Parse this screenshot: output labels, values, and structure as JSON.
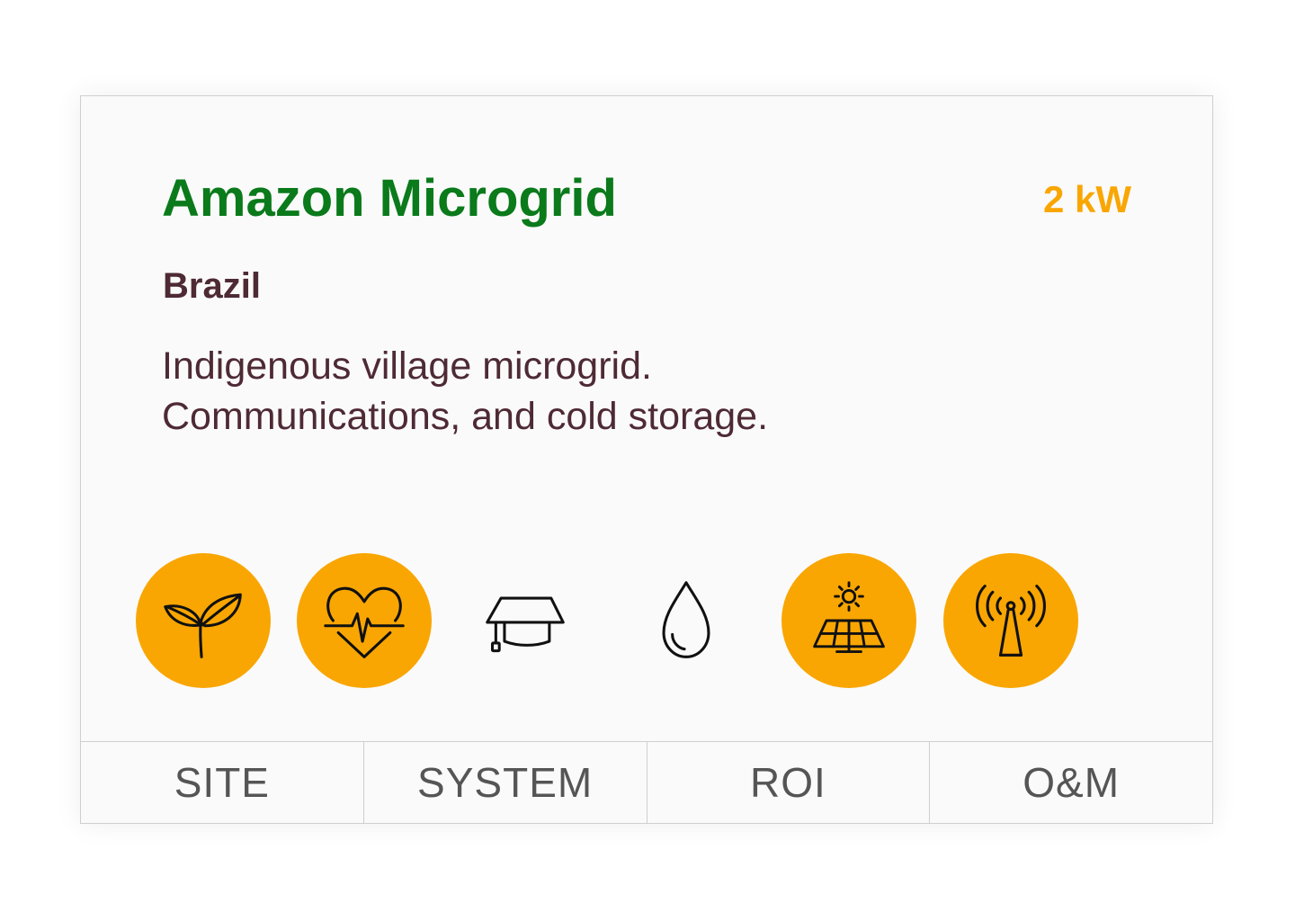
{
  "colors": {
    "title": "#0a7a1b",
    "accent": "#f9a602",
    "text": "#4e2a35",
    "tab_text": "#555555",
    "border": "#cfcfcf",
    "card_bg": "#fafafa"
  },
  "project": {
    "title": "Amazon Microgrid",
    "power": "2 kW",
    "location": "Brazil",
    "description_lines": [
      "Indigenous village microgrid.",
      "Communications, and cold storage."
    ]
  },
  "icons": [
    {
      "name": "agriculture-icon",
      "active": true
    },
    {
      "name": "health-icon",
      "active": true
    },
    {
      "name": "education-icon",
      "active": false
    },
    {
      "name": "water-icon",
      "active": false
    },
    {
      "name": "solar-panel-icon",
      "active": true
    },
    {
      "name": "communications-tower-icon",
      "active": true
    }
  ],
  "tabs": [
    "SITE",
    "SYSTEM",
    "ROI",
    "O&M"
  ]
}
